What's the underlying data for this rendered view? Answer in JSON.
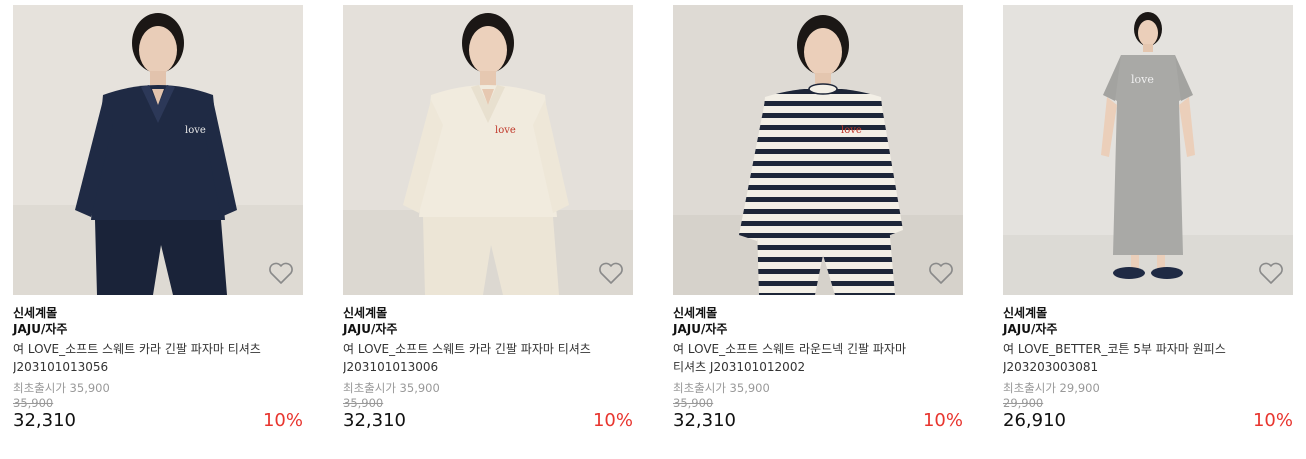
{
  "products": [
    {
      "tag": "신세계몰",
      "brand": "JAJU/자주",
      "name": "여 LOVE_소프트 스웨트 카라 긴팔 파자마 티셔츠 J203101013056",
      "release_label": "최초출시가 35,900",
      "original_price": "35,900",
      "price": "32,310",
      "discount": "10%",
      "outfit": "navy collar sweatshirt pajama set",
      "colors": {
        "bg": "#e6e2dc",
        "top": "#1f2a44",
        "bottom": "#1f2a44"
      }
    },
    {
      "tag": "신세계몰",
      "brand": "JAJU/자주",
      "name": "여 LOVE_소프트 스웨트 카라 긴팔 파자마 티셔츠 J203101013006",
      "release_label": "최초출시가 35,900",
      "original_price": "35,900",
      "price": "32,310",
      "discount": "10%",
      "outfit": "ivory collar sweatshirt pajama set",
      "colors": {
        "bg": "#e4e0da",
        "top": "#f1ebde",
        "bottom": "#efe8da"
      }
    },
    {
      "tag": "신세계몰",
      "brand": "JAJU/자주",
      "name": "여 LOVE_소프트 스웨트 라운드넥 긴팔 파자마 티셔츠 J203101012002",
      "release_label": "최초출시가 35,900",
      "original_price": "35,900",
      "price": "32,310",
      "discount": "10%",
      "outfit": "striped round-neck pajama set",
      "colors": {
        "bg": "#dedad4",
        "top": "#f3efe6",
        "bottom": "#f3efe6"
      }
    },
    {
      "tag": "신세계몰",
      "brand": "JAJU/자주",
      "name": "여 LOVE_BETTER_코튼 5부 파자마 원피스 J203203003081",
      "release_label": "최초출시가 29,900",
      "original_price": "29,900",
      "price": "26,910",
      "discount": "10%",
      "outfit": "gray short-sleeve pajama dress",
      "colors": {
        "bg": "#e4e2de",
        "top": "#a9a9a6",
        "bottom": "#a9a9a6"
      }
    }
  ],
  "icons": {
    "wishlist": "heart-outline-icon"
  },
  "accent_color": "#e8352e"
}
